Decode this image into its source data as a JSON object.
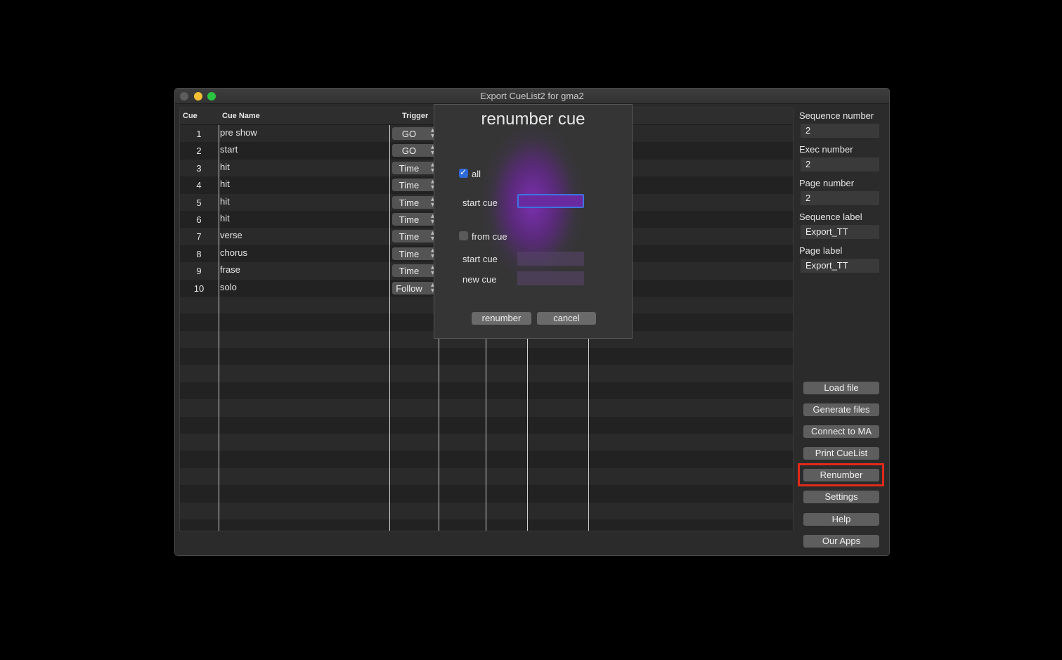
{
  "window": {
    "title": "Export CueList2 for gma2"
  },
  "table": {
    "headers": {
      "cue": "Cue",
      "cue_name": "Cue Name",
      "trigger": "Trigger"
    },
    "rows": [
      {
        "cue": "1",
        "name": "pre show",
        "trigger": "GO"
      },
      {
        "cue": "2",
        "name": "start",
        "trigger": "GO"
      },
      {
        "cue": "3",
        "name": "hit",
        "trigger": "Time"
      },
      {
        "cue": "4",
        "name": "hit",
        "trigger": "Time"
      },
      {
        "cue": "5",
        "name": "hit",
        "trigger": "Time"
      },
      {
        "cue": "6",
        "name": "hit",
        "trigger": "Time"
      },
      {
        "cue": "7",
        "name": "verse",
        "trigger": "Time"
      },
      {
        "cue": "8",
        "name": "chorus",
        "trigger": "Time"
      },
      {
        "cue": "9",
        "name": "frase",
        "trigger": "Time"
      },
      {
        "cue": "10",
        "name": "solo",
        "trigger": "Follow"
      }
    ]
  },
  "panel": {
    "sequence_number_label": "Sequence number",
    "sequence_number": "2",
    "exec_number_label": "Exec number",
    "exec_number": "2",
    "page_number_label": "Page number",
    "page_number": "2",
    "sequence_label_label": "Sequence label",
    "sequence_label": "Export_TT",
    "page_label_label": "Page label",
    "page_label": "Export_TT",
    "buttons": {
      "load_file": "Load file",
      "generate_files": "Generate files",
      "connect": "Connect to MA",
      "print": "Print CueList",
      "renumber": "Renumber",
      "settings": "Settings",
      "help": "Help",
      "our_apps": "Our Apps"
    },
    "highlight_color": "#e02a1a"
  },
  "modal": {
    "title": "renumber cue",
    "all_label": "all",
    "all_checked": true,
    "start_cue_label": "start cue",
    "start_cue_value": "",
    "from_cue_label": "from cue",
    "from_cue_checked": false,
    "from_start_cue_label": "start cue",
    "new_cue_label": "new cue",
    "renumber_button": "renumber",
    "cancel_button": "cancel"
  }
}
